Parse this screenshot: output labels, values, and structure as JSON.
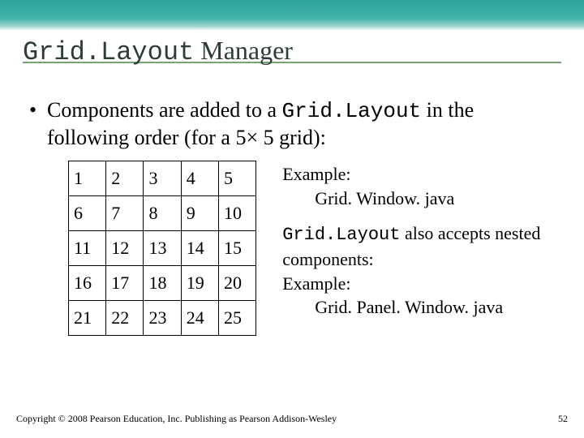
{
  "title": {
    "mono": "Grid.Layout",
    "plain": " Manager"
  },
  "bullet": {
    "dot": "•",
    "pre": "Components are added to a ",
    "mono": "Grid.Layout",
    "post": " in the following order (for a 5× 5 grid):"
  },
  "grid": {
    "rows": [
      [
        "1",
        "2",
        "3",
        "4",
        "5"
      ],
      [
        "6",
        "7",
        "8",
        "9",
        "10"
      ],
      [
        "11",
        "12",
        "13",
        "14",
        "15"
      ],
      [
        "16",
        "17",
        "18",
        "19",
        "20"
      ],
      [
        "21",
        "22",
        "23",
        "24",
        "25"
      ]
    ]
  },
  "notes": {
    "ex1_label": "Example:",
    "ex1_value": "Grid. Window. java",
    "line2_mono": "Grid.Layout",
    "line2_rest": " also accepts nested components:",
    "ex2_label": "Example:",
    "ex2_value": "Grid. Panel. Window. java"
  },
  "footer": {
    "copyright": "Copyright © 2008 Pearson Education, Inc. Publishing as Pearson Addison-Wesley",
    "page": "52"
  }
}
